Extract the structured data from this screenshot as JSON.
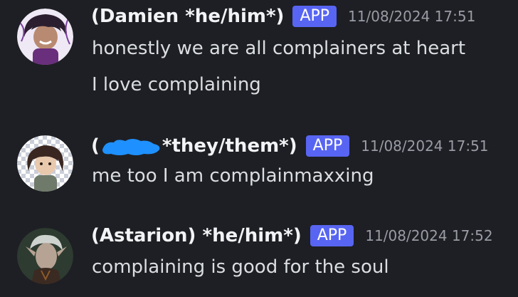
{
  "messages": [
    {
      "username": "(Damien *he/him*)",
      "badge": "APP",
      "timestamp": "11/08/2024 17:51",
      "lines": [
        "honestly we are all complainers at heart",
        "I love complaining"
      ],
      "avatar_icon": "avatar-curly-hair-character",
      "avatar_bg": "#5a3a78"
    },
    {
      "username_prefix": "(",
      "username_suffix": "*they/them*)",
      "badge": "APP",
      "timestamp": "11/08/2024 17:51",
      "lines": [
        "me too I am complainmaxxing"
      ],
      "avatar_icon": "avatar-checkered-character",
      "redaction_color": "#1e90ff"
    },
    {
      "username": "(Astarion) *he/him*)",
      "badge": "APP",
      "timestamp": "11/08/2024 17:52",
      "lines": [
        "complaining is good for the soul"
      ],
      "avatar_icon": "avatar-elf-character",
      "avatar_bg": "#2e3b30"
    }
  ],
  "colors": {
    "background": "#1e1f24",
    "badge": "#5865f2",
    "username": "#f2f3f5",
    "message_text": "#dbdee1",
    "timestamp": "#9a9ca5"
  }
}
